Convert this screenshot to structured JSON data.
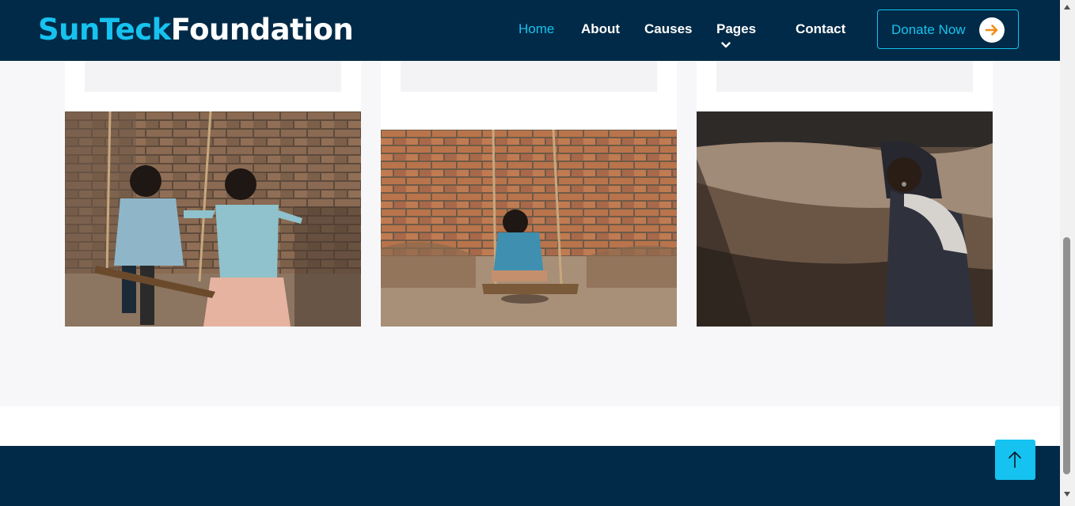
{
  "brand": {
    "part1": "SunTeck",
    "part2": "Foundation"
  },
  "nav": {
    "items": [
      {
        "label": "Home",
        "active": true
      },
      {
        "label": "About"
      },
      {
        "label": "Causes"
      },
      {
        "label": "Pages",
        "dropdown": true
      },
      {
        "label": "Contact"
      }
    ],
    "donate_label": "Donate Now"
  },
  "colors": {
    "navy": "#002a47",
    "accent": "#16c2ef",
    "arrow": "#f28c16"
  },
  "cards": [
    {
      "image": "two-children-on-swings-photo"
    },
    {
      "image": "child-on-swing-photo"
    },
    {
      "image": "girl-in-headscarf-photo"
    }
  ]
}
